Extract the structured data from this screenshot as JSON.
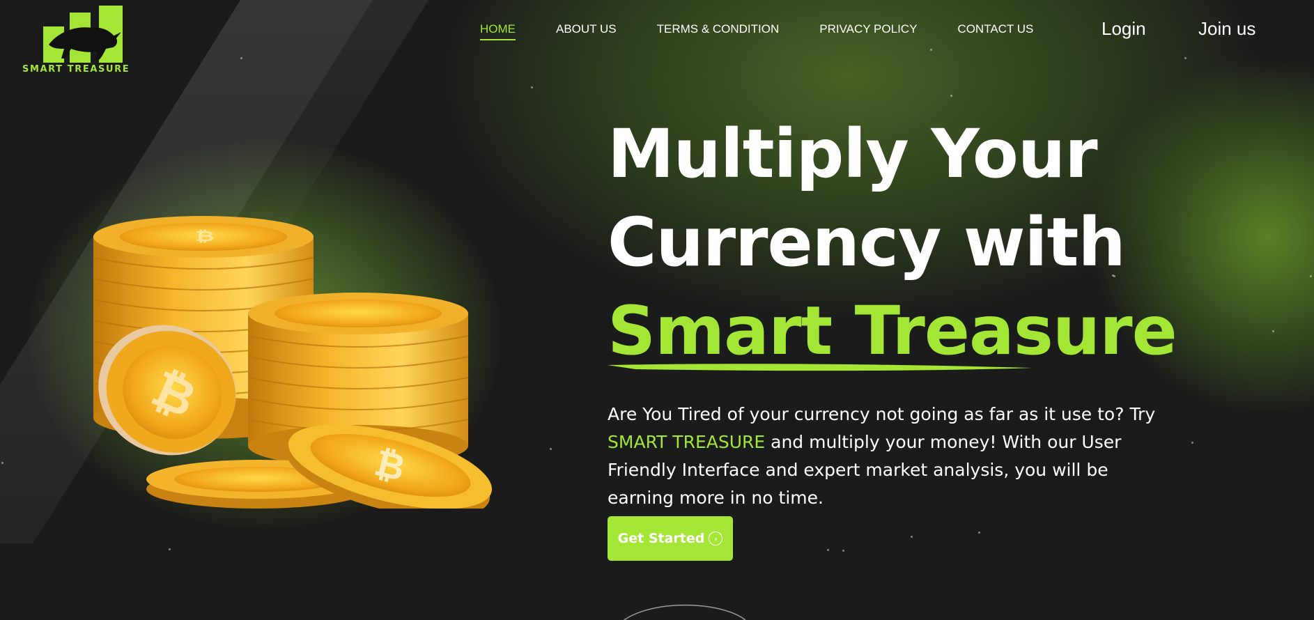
{
  "brand": {
    "name": "SMART TREASURE",
    "accent_color": "#a3e635",
    "background_color": "#1b1b1b"
  },
  "nav": {
    "items": [
      {
        "label": "HOME",
        "active": true
      },
      {
        "label": "ABOUT US",
        "active": false
      },
      {
        "label": "TERMS & CONDITION",
        "active": false
      },
      {
        "label": "PRIVACY POLICY",
        "active": false
      },
      {
        "label": "CONTACT US",
        "active": false
      }
    ],
    "login_label": "Login",
    "join_label": "Join us"
  },
  "hero": {
    "line1": "Multiply Your",
    "line2": "Currency with",
    "line3": "Smart Treasure",
    "description_part1": "Are You Tired of your currency not going as far as it use to? Try ",
    "description_highlight": "SMART TREASURE",
    "description_part2": " and multiply your money! With our User Friendly Interface and expert market analysis, you will be earning more in no time.",
    "cta_label": "Get Started",
    "cta_icon": "chevron-right-circle-icon",
    "illustration": "bitcoin-coins-stack"
  }
}
